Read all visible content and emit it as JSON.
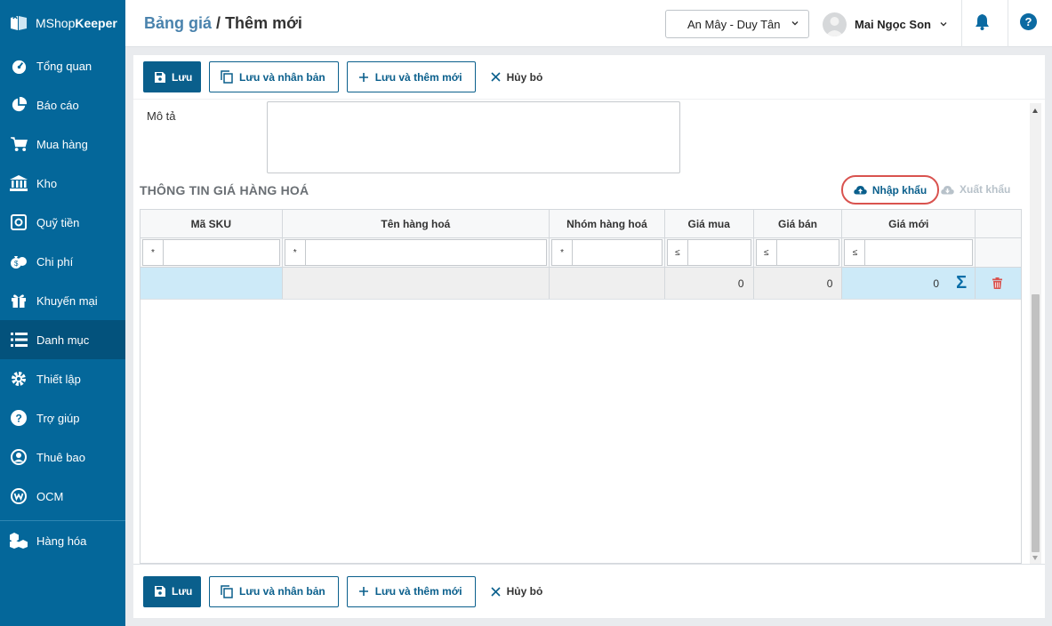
{
  "app": {
    "logo_prefix": "MShop",
    "logo_suffix": "Keeper"
  },
  "sidebar": {
    "items": [
      {
        "label": "Tổng quan",
        "icon": "dashboard-icon"
      },
      {
        "label": "Báo cáo",
        "icon": "pie-chart-icon"
      },
      {
        "label": "Mua hàng",
        "icon": "cart-icon"
      },
      {
        "label": "Kho",
        "icon": "bank-icon"
      },
      {
        "label": "Quỹ tiền",
        "icon": "safe-icon"
      },
      {
        "label": "Chi phí",
        "icon": "money-bag-icon"
      },
      {
        "label": "Khuyến mại",
        "icon": "gift-icon"
      },
      {
        "label": "Danh mục",
        "icon": "list-icon",
        "active": true
      },
      {
        "label": "Thiết lập",
        "icon": "gear-icon"
      },
      {
        "label": "Trợ giúp",
        "icon": "help-circle-icon"
      },
      {
        "label": "Thuê bao",
        "icon": "user-circle-icon"
      },
      {
        "label": "OCM",
        "icon": "ocm-icon"
      },
      {
        "label": "Hàng hóa",
        "icon": "boxes-icon"
      }
    ]
  },
  "header": {
    "breadcrumb_link": "Bảng giá",
    "breadcrumb_sep": "/",
    "breadcrumb_current": "Thêm mới",
    "branch": "An Mây - Duy Tân",
    "user_name": "Mai Ngọc Son"
  },
  "toolbar": {
    "save": "Lưu",
    "save_copy": "Lưu và nhân bản",
    "save_new": "Lưu và thêm mới",
    "cancel": "Hủy bỏ"
  },
  "form": {
    "description_label": "Mô tả",
    "description_value": ""
  },
  "section": {
    "title": "THÔNG TIN GIÁ HÀNG HOÁ",
    "import": "Nhập khẩu",
    "export": "Xuất khẩu"
  },
  "grid": {
    "columns": [
      "Mã SKU",
      "Tên hàng hoá",
      "Nhóm hàng hoá",
      "Giá mua",
      "Giá bán",
      "Giá mới"
    ],
    "filter_ops": [
      "*",
      "*",
      "*",
      "≤",
      "≤",
      "≤"
    ],
    "rows": [
      {
        "sku": "",
        "name": "",
        "group": "",
        "buy": "0",
        "sell": "0",
        "new": "0"
      }
    ]
  },
  "colors": {
    "sidebar": "#04679a",
    "sidebar_active": "#03527c",
    "primary": "#0a5f8c",
    "highlight_ring": "#d9534f",
    "selected_cell": "#cdeaf8",
    "delete": "#d9534f"
  }
}
